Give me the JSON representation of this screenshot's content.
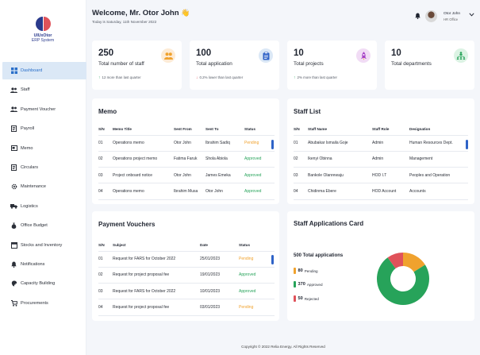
{
  "brand": {
    "line1": "UIUxOtor",
    "line2": "ERP System"
  },
  "sidebar": {
    "items": [
      {
        "label": "Dashboard",
        "icon": "grid-icon",
        "active": true
      },
      {
        "label": "Staff",
        "icon": "users-icon"
      },
      {
        "label": "Payment Voucher",
        "icon": "users-icon"
      },
      {
        "label": "Payroll",
        "icon": "document-icon"
      },
      {
        "label": "Memo",
        "icon": "memo-icon"
      },
      {
        "label": "Circulars",
        "icon": "document-icon"
      },
      {
        "label": "Maintenance",
        "icon": "gear-icon"
      },
      {
        "label": "Logistics",
        "icon": "truck-icon"
      },
      {
        "label": "Office Budget",
        "icon": "money-bag-icon"
      },
      {
        "label": "Stocks and Inventory",
        "icon": "box-icon"
      },
      {
        "label": "Notifications",
        "icon": "bell-icon"
      },
      {
        "label": "Capacity Building",
        "icon": "brain-icon"
      },
      {
        "label": "Procurements",
        "icon": "cart-icon"
      }
    ]
  },
  "header": {
    "welcome": "Welcome, Mr. Otor John",
    "wave": "👋",
    "date": "Today is Saturday, 11th November 2022",
    "user_name": "Otor John",
    "user_role": "HR Office"
  },
  "stats": [
    {
      "value": "250",
      "label": "Total number of staff",
      "sub": "12 more than last quarter",
      "trend": "up",
      "icon": "people-icon",
      "icon_bg": "#fdebd5",
      "icon_color": "#f0a22e"
    },
    {
      "value": "100",
      "label": "Total application",
      "sub": "0.2% lower than last quarter",
      "trend": "down",
      "icon": "clipboard-icon",
      "icon_bg": "#dbe8f6",
      "icon_color": "#2f63c7"
    },
    {
      "value": "10",
      "label": "Total projects",
      "sub": "2% more than last quarter",
      "trend": "up",
      "icon": "rocket-icon",
      "icon_bg": "#f1dcf5",
      "icon_color": "#a743c7"
    },
    {
      "value": "10",
      "label": "Total departments",
      "sub": "",
      "trend": "",
      "icon": "org-chart-icon",
      "icon_bg": "#dcf3e4",
      "icon_color": "#27a35a"
    }
  ],
  "memo": {
    "title": "Memo",
    "columns": [
      "S/N",
      "Memo Title",
      "Sent From",
      "Sent To",
      "Status"
    ],
    "rows": [
      [
        "01",
        "Operations memo",
        "Otor John",
        "Ibrahim Sadiq",
        "Pending"
      ],
      [
        "02",
        "Operations project memo",
        "Fatima Faruk",
        "Shola Abiola",
        "Approved"
      ],
      [
        "03",
        "Project onboard notice",
        "Otor John",
        "James Emeka",
        "Approved"
      ],
      [
        "04",
        "Operations memo",
        "Ibrahim Musa",
        "Otor John",
        "Approved"
      ]
    ]
  },
  "staff": {
    "title": "Staff List",
    "columns": [
      "S/N",
      "Staff Name",
      "Staff Role",
      "Designation"
    ],
    "rows": [
      [
        "01",
        "Abubakar Ismaila Goje",
        "Admin",
        "Human Resources Dept."
      ],
      [
        "02",
        "Ikenyi Obinna",
        "Admin",
        "Management"
      ],
      [
        "03",
        "Bankole Olanrewaju",
        "HOD I.T",
        "Peoples and Operation"
      ],
      [
        "04",
        "Chidinma Ebere",
        "HOD Account",
        "Accounts"
      ]
    ]
  },
  "vouchers": {
    "title": "Payment Vouchers",
    "columns": [
      "S/N",
      "Subject",
      "Date",
      "Status"
    ],
    "rows": [
      [
        "01",
        "Request for FARS for October 2022",
        "25/01/2023",
        "Pending"
      ],
      [
        "02",
        "Request for project proposal fee",
        "19/01/2023",
        "Approved"
      ],
      [
        "03",
        "Request for FARS for October 2022",
        "10/01/2023",
        "Approved"
      ],
      [
        "04",
        "Request for project proposal fee",
        "03/01/2023",
        "Pending"
      ]
    ]
  },
  "applications": {
    "title": "Staff Applications Card",
    "total": "500 Total applications",
    "legend": [
      {
        "value": "80",
        "label": "Pending",
        "color": "#f0a22e"
      },
      {
        "value": "370",
        "label": "Approved",
        "color": "#27a35a"
      },
      {
        "value": "50",
        "label": "Rejected",
        "color": "#e0525a"
      }
    ]
  },
  "chart_data": {
    "type": "pie",
    "categories": [
      "Pending",
      "Approved",
      "Rejected"
    ],
    "values": [
      80,
      370,
      50
    ],
    "colors": [
      "#f0a22e",
      "#27a35a",
      "#e0525a"
    ],
    "title": "Staff Applications Card"
  },
  "footer": "Copyright © 2022 Relia Energy. All Rights Reserved"
}
